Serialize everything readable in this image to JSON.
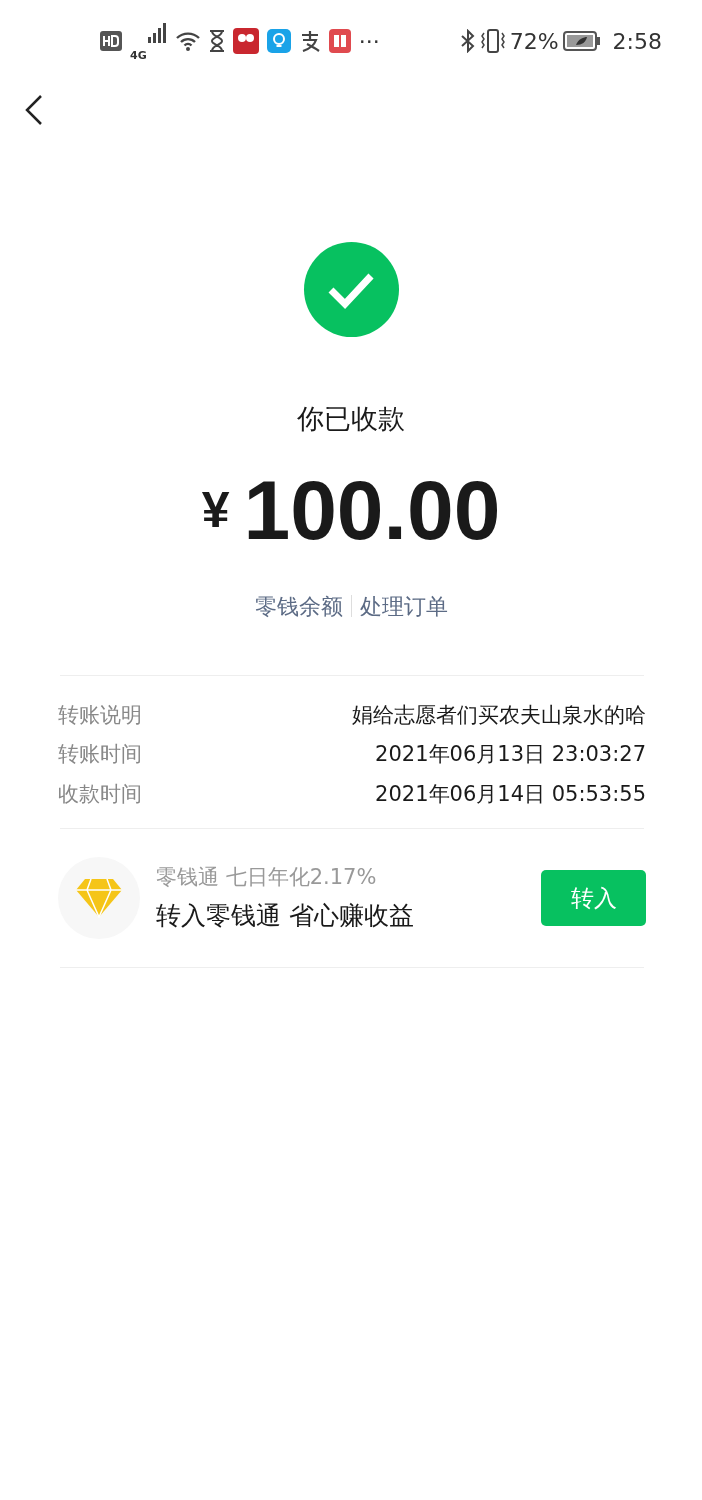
{
  "status_bar": {
    "network": "4G",
    "more": "···",
    "battery_percent": "72%",
    "time": "2:58"
  },
  "header": {
    "title": "你已收款",
    "currency": "¥",
    "amount": "100.00"
  },
  "links": [
    "零钱余额",
    "处理订单"
  ],
  "details": [
    {
      "label": "转账说明",
      "value": "娟给志愿者们买农夫山泉水的哈"
    },
    {
      "label": "转账时间",
      "value": "2021年06月13日 23:03:27"
    },
    {
      "label": "收款时间",
      "value": "2021年06月14日 05:53:55"
    }
  ],
  "promo": {
    "subtitle": "零钱通 七日年化2.17%",
    "title": "转入零钱通 省心赚收益",
    "button": "转入"
  }
}
